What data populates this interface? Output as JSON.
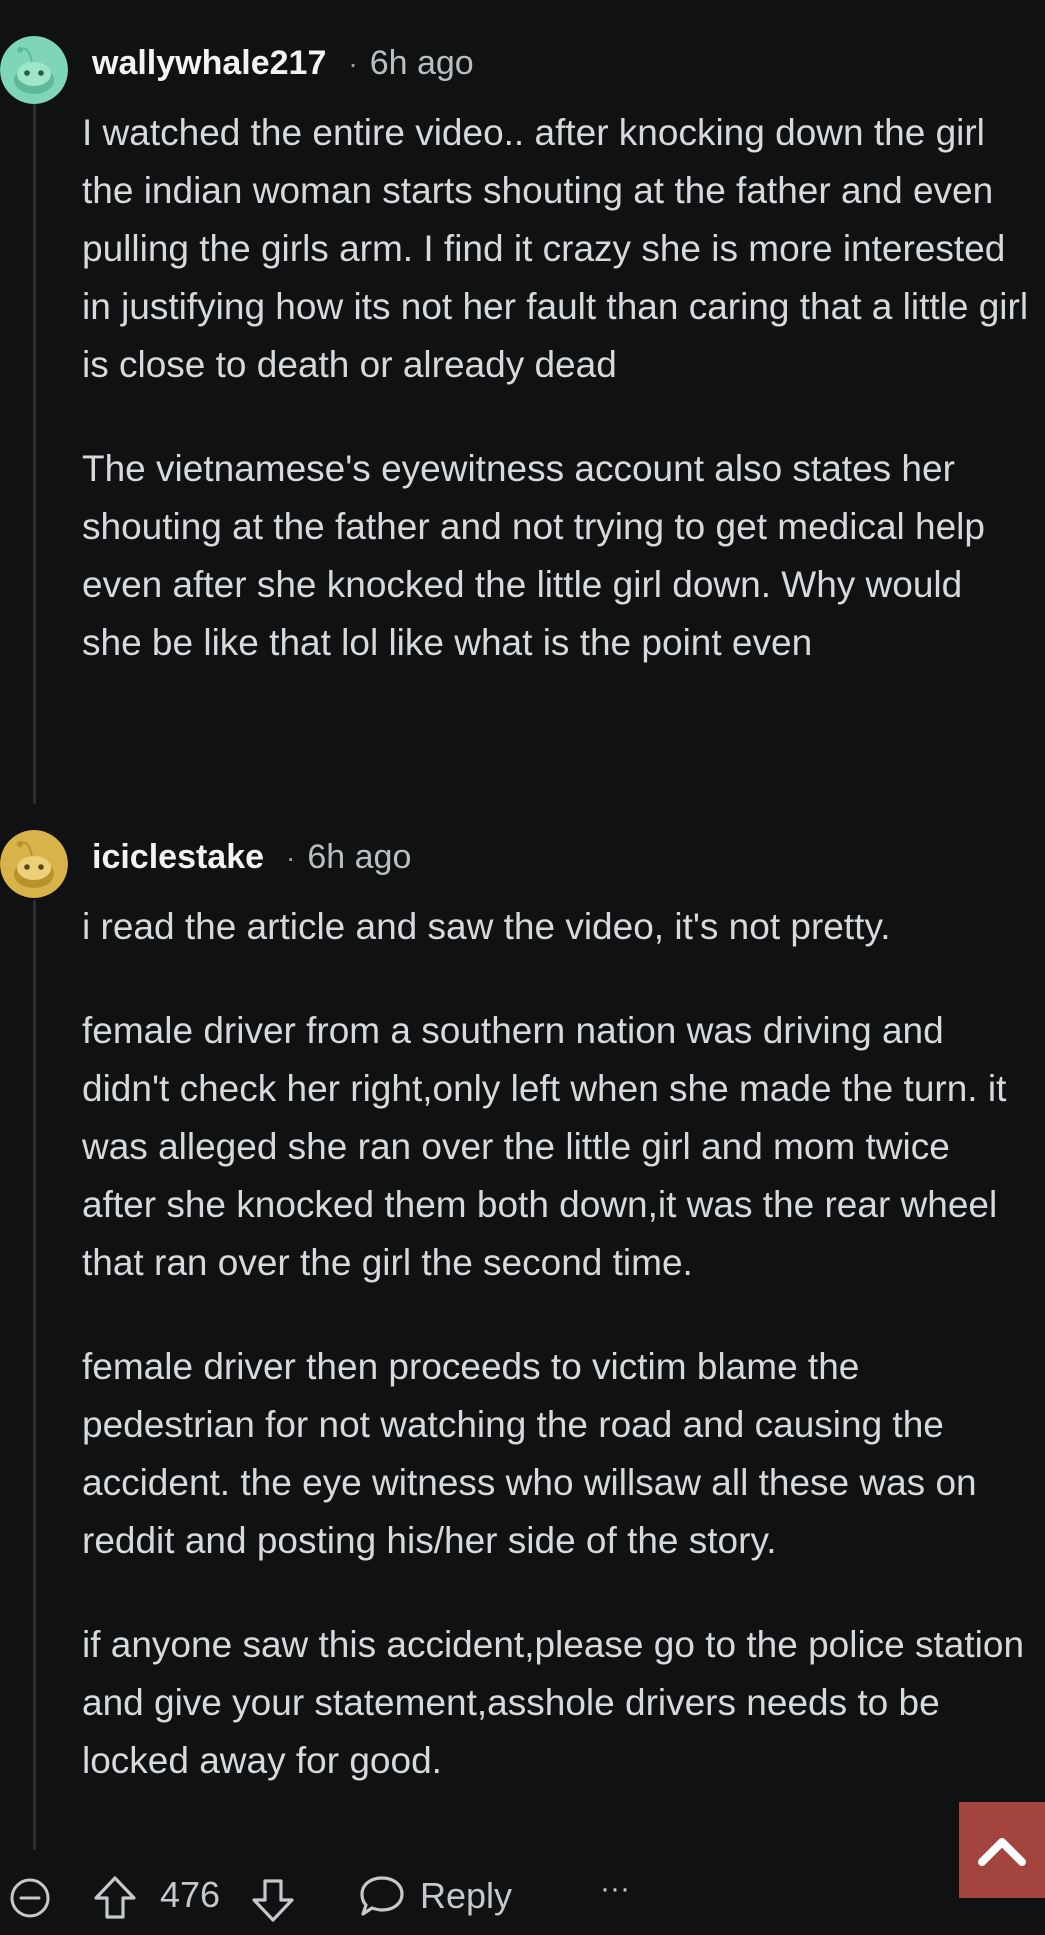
{
  "comments": [
    {
      "username": "wallywhale217",
      "separator": "·",
      "time": "6h ago",
      "avatar_color": "#7fd6b6",
      "paragraphs": [
        "I watched the entire video.. after knocking down the girl the indian woman starts shouting at the father and even pulling the girls arm. I find it crazy she is more interested in justifying how its not her fault than caring that a little girl is close to death or already dead",
        "The vietnamese's eyewitness account also states her shouting at the father and not trying to get medical help even after she knocked the little girl down. Why would she be like that lol like what is the point even"
      ]
    },
    {
      "username": "iciclestake",
      "separator": "·",
      "time": "6h ago",
      "avatar_color": "#d8b34a",
      "paragraphs": [
        "i read the article and saw the video, it's not pretty.",
        "female driver from a southern nation was driving and didn't check her right,only left when she made the turn. it was alleged she ran over the little girl and mom twice after she knocked them both down,it was the rear wheel that ran over the girl the second time.",
        "female driver then proceeds to victim blame the pedestrian for not watching the road and causing the accident. the eye witness who willsaw all these was on reddit and posting his/her side of the story.",
        "if anyone saw this accident,please go to the police station and give your statement,asshole drivers needs to be locked away for good."
      ]
    }
  ],
  "actions": {
    "collapse_icon": "collapse-minus-icon",
    "upvote_icon": "upvote-arrow-icon",
    "score": "476",
    "downvote_icon": "downvote-arrow-icon",
    "reply_icon": "speech-bubble-icon",
    "reply_label": "Reply",
    "more_label": "···"
  },
  "scroll_top": {
    "icon": "chevron-up-icon",
    "color": "#a3443f"
  },
  "colors": {
    "background": "#0f1113",
    "text": "#d7dadc",
    "thread_line": "#2a2e31"
  }
}
